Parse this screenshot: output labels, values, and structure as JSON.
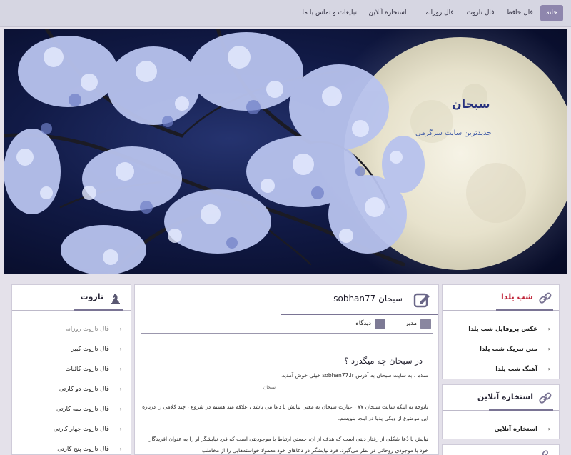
{
  "nav": {
    "items": [
      {
        "label": "خانه",
        "active": true
      },
      {
        "label": "فال حافظ"
      },
      {
        "label": "فال تاروت"
      },
      {
        "label": "فال روزانه"
      },
      {
        "label": "استخاره آنلاین"
      },
      {
        "label": "تبلیغات و تماس با ما"
      }
    ]
  },
  "hero": {
    "title": "سبحان",
    "subtitle": "جدیدترین سایت سرگرمی"
  },
  "left_panel": {
    "title": "تاروت",
    "items": [
      "فال تاروت روزانه",
      "فال تاروت کبیر",
      "فال تاروت کائنات",
      "فال تاروت دو کارتی",
      "فال تاروت سه کارتی",
      "فال تاروت چهار کارتی",
      "فال تاروت پنج کارتی"
    ]
  },
  "post": {
    "title": "سبحان sobhan77",
    "author": "مدیر",
    "category": "دیدگاه",
    "heading": "در سبحان چه میگذرد ؟",
    "paragraphs": [
      "سلام ، به سایت سبحان به آدرس sobhan77.ir خیلی خوش آمدید.",
      "باتوجه به اینکه سایت سبحان ۷۷ ، عبارت سبحان به معنی نیایش یا دعا می باشد ، علاقه مند هستم در شروع ، چند کلامی را درباره این موضوع از ویکی پدیا در اینجا بنویسم.",
      "نیایش یا دُعا شکلی از رفتار دینی است که هدف از آن، جستن ارتباط با موجودیتی است که فرد نیایشگر او را به عنوان آفریدگار خود یا موجودی روحانی در نظر می‌گیرد. فرد نیایشگر در دعاهای خود معمولا خواسته‌هایی را از مخاطب"
    ],
    "signature": "سبحان"
  },
  "right_panels": [
    {
      "title": "شب یلدا",
      "title_color": "#c0263a",
      "items": [
        "عکس پروفایل شب یلدا",
        "متن تبریک شب یلدا",
        "آهنگ شب یلدا"
      ]
    },
    {
      "title": "استخاره آنلاین",
      "title_color": "#2a2838",
      "items": [
        "استخاره آنلاین"
      ]
    },
    {
      "title": "",
      "items": []
    }
  ],
  "colors": {
    "nav_active": "#8e86ad",
    "hero_title": "#26307e",
    "hero_subtitle": "#3f5aa6",
    "accent": "#7a7494"
  },
  "icons": [
    "tarot-card-icon",
    "edit-icon",
    "link-icon",
    "user-icon",
    "comment-icon",
    "chevron-left-icon"
  ]
}
